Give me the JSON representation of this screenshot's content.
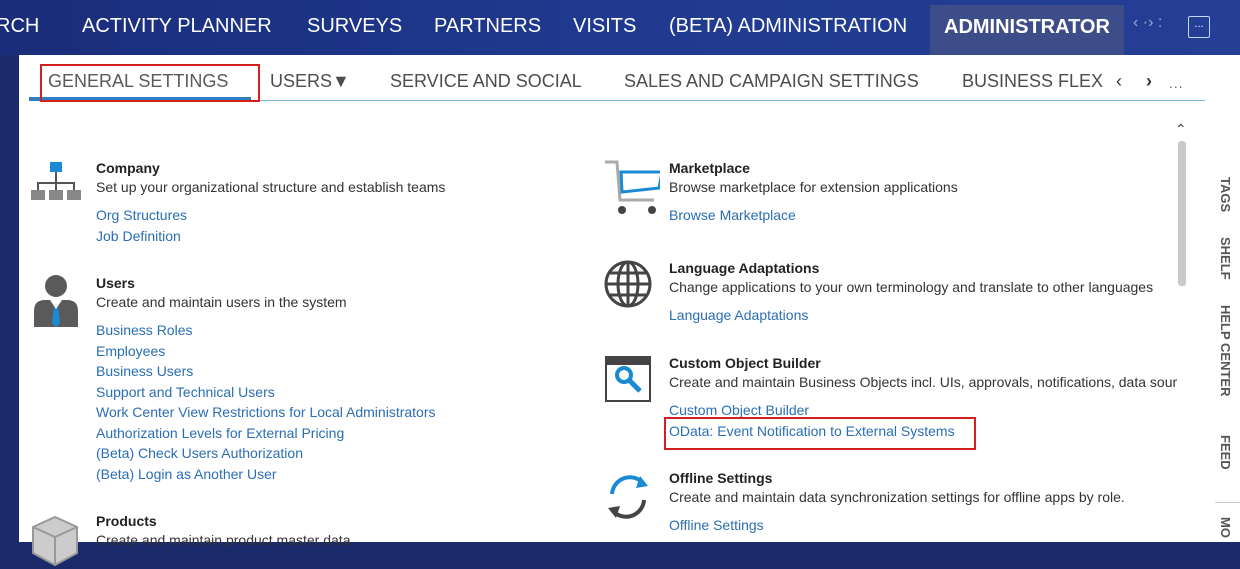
{
  "topnav": {
    "items": [
      "RCH",
      "ACTIVITY PLANNER",
      "SURVEYS",
      "PARTNERS",
      "VISITS",
      "(BETA) ADMINISTRATION"
    ],
    "active": "ADMINISTRATOR",
    "arrows": "‹ ·› :",
    "more": "..."
  },
  "tabs": {
    "items": [
      "GENERAL SETTINGS",
      "USERS▼",
      "SERVICE AND SOCIAL",
      "SALES AND CAMPAIGN SETTINGS",
      "BUSINESS FLEX"
    ],
    "prev": "‹",
    "next": "›",
    "more": "..."
  },
  "sections": {
    "company": {
      "title": "Company",
      "desc": "Set up your organizational structure and establish teams",
      "links": [
        "Org Structures",
        "Job Definition"
      ]
    },
    "users": {
      "title": "Users",
      "desc": "Create and maintain users in the system",
      "links": [
        "Business Roles",
        "Employees",
        "Business Users",
        "Support and Technical Users",
        "Work Center View Restrictions for Local Administrators",
        "Authorization Levels for External Pricing",
        "(Beta) Check Users Authorization",
        "(Beta) Login as Another User"
      ]
    },
    "products": {
      "title": "Products",
      "desc": "Create and maintain product master data"
    },
    "marketplace": {
      "title": "Marketplace",
      "desc": "Browse marketplace for extension applications",
      "links": [
        "Browse Marketplace"
      ]
    },
    "language": {
      "title": "Language Adaptations",
      "desc": "Change applications to your own terminology and translate to other languages",
      "links": [
        "Language Adaptations"
      ]
    },
    "custom_object": {
      "title": "Custom Object Builder",
      "desc": "Create and maintain Business Objects incl. UIs, approvals, notifications, data sour",
      "links": [
        "Custom Object Builder",
        "OData: Event Notification to External Systems"
      ]
    },
    "offline": {
      "title": "Offline Settings",
      "desc": "Create and maintain data synchronization settings for offline apps by role.",
      "links": [
        "Offline Settings"
      ]
    }
  },
  "rightbar": [
    "TAGS",
    "SHELF",
    "HELP CENTER",
    "FEED",
    "MO"
  ],
  "colors": {
    "nav_bg": "#1f3a8f",
    "link": "#2a6eb3",
    "highlight": "#d21f1f",
    "tab_underline": "#2f7fc0"
  }
}
